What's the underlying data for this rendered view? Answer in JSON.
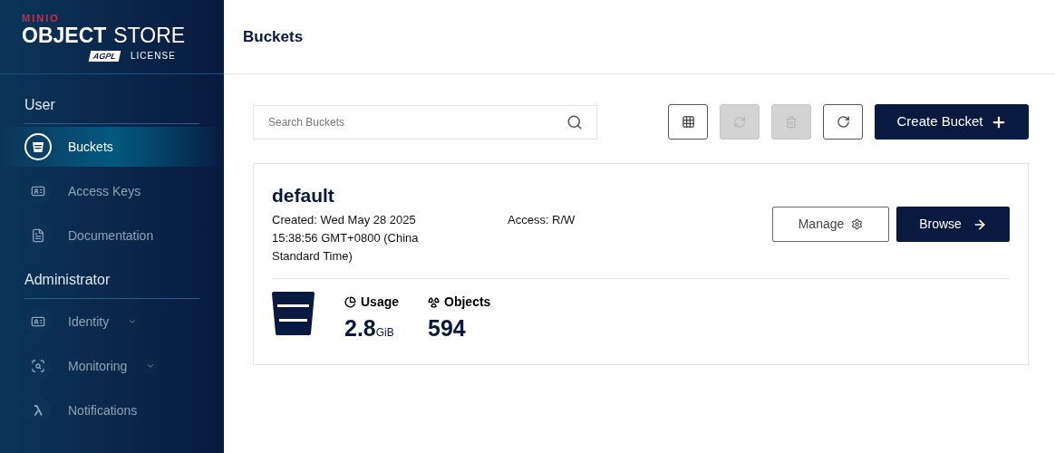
{
  "logo": {
    "brand": "MINIO",
    "product_bold": "OBJECT",
    "product_light": "STORE",
    "badge": "AGPL",
    "license": "LICENSE"
  },
  "sidebar": {
    "sections": [
      {
        "title": "User",
        "items": [
          {
            "label": "Buckets",
            "kind": "bucket",
            "selected": true
          },
          {
            "label": "Access Keys",
            "kind": "keys",
            "selected": false
          },
          {
            "label": "Documentation",
            "kind": "docs",
            "selected": false
          }
        ]
      },
      {
        "title": "Administrator",
        "items": [
          {
            "label": "Identity",
            "kind": "identity",
            "selected": false,
            "expandable": true
          },
          {
            "label": "Monitoring",
            "kind": "monitor",
            "selected": false,
            "expandable": true
          },
          {
            "label": "Notifications",
            "kind": "lambda",
            "selected": false
          }
        ]
      }
    ]
  },
  "header": {
    "title": "Buckets"
  },
  "search": {
    "placeholder": "Search Buckets"
  },
  "toolbar": [
    {
      "kind": "grid",
      "disabled": false
    },
    {
      "kind": "sync",
      "disabled": true
    },
    {
      "kind": "delete",
      "disabled": true
    },
    {
      "kind": "refresh",
      "disabled": false
    }
  ],
  "create_button": "Create Bucket",
  "bucket": {
    "name": "default",
    "created": "Created: Wed May 28 2025 15:38:56 GMT+0800 (China Standard Time)",
    "access": "Access: R/W",
    "manage": "Manage",
    "browse": "Browse",
    "usage_label": "Usage",
    "usage_value": "2.8",
    "usage_unit": "GiB",
    "objects_label": "Objects",
    "objects_value": "594"
  }
}
